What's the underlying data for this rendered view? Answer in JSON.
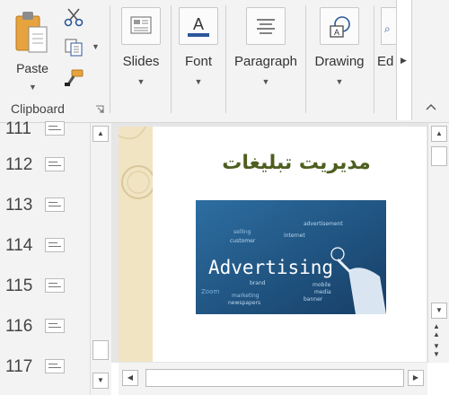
{
  "ribbon": {
    "clipboard": {
      "paste_label": "Paste",
      "group_label": "Clipboard",
      "icons": [
        "paste-icon",
        "cut-icon",
        "copy-icon",
        "format-painter-icon",
        "dialog-launcher-icon"
      ]
    },
    "buttons": [
      {
        "label": "Slides",
        "icon": "slides-icon"
      },
      {
        "label": "Font",
        "icon": "font-color-icon"
      },
      {
        "label": "Paragraph",
        "icon": "align-icon"
      },
      {
        "label": "Drawing",
        "icon": "shapes-icon"
      },
      {
        "label": "Ed",
        "icon": "editing-icon"
      }
    ]
  },
  "slides_panel": {
    "slide_numbers": [
      "111",
      "112",
      "113",
      "114",
      "115",
      "116",
      "117"
    ]
  },
  "slide": {
    "title": "مدیریت تبلیغات",
    "image_words": {
      "main": "Advertising",
      "others": [
        "selling",
        "customer",
        "internet",
        "mobile",
        "brand",
        "media",
        "banner",
        "newspapers",
        "marketing",
        "Zoom",
        "advertisement"
      ]
    }
  },
  "colors": {
    "ribbon_bg": "#f3f3f3",
    "title_green": "#4d5f1f",
    "slide_band": "#f1e4c3",
    "font_underline": "#2b579a"
  }
}
